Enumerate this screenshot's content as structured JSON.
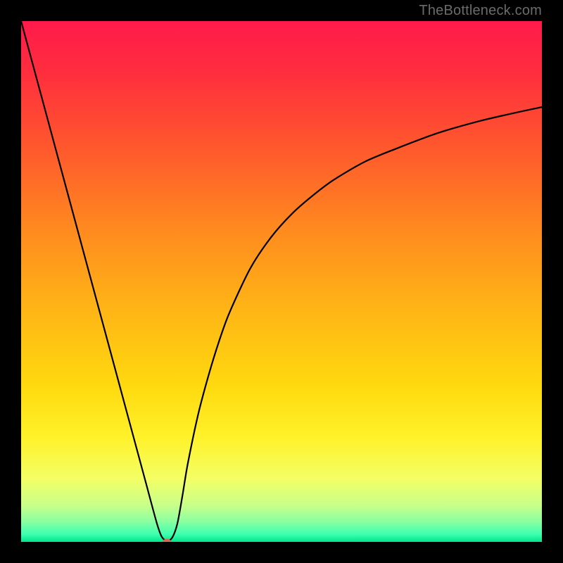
{
  "watermark": "TheBottleneck.com",
  "chart_data": {
    "type": "line",
    "title": "",
    "xlabel": "",
    "ylabel": "",
    "xlim": [
      0,
      100
    ],
    "ylim": [
      0,
      100
    ],
    "grid": false,
    "legend": false,
    "background_gradient": {
      "direction": "vertical",
      "stops": [
        {
          "pos": 0.0,
          "color": "#ff1a4b"
        },
        {
          "pos": 0.1,
          "color": "#ff2e3e"
        },
        {
          "pos": 0.25,
          "color": "#ff5a2c"
        },
        {
          "pos": 0.4,
          "color": "#ff8a1f"
        },
        {
          "pos": 0.55,
          "color": "#ffb416"
        },
        {
          "pos": 0.7,
          "color": "#ffd90f"
        },
        {
          "pos": 0.8,
          "color": "#fff22a"
        },
        {
          "pos": 0.88,
          "color": "#f3ff66"
        },
        {
          "pos": 0.93,
          "color": "#c8ff8a"
        },
        {
          "pos": 0.96,
          "color": "#8cffa0"
        },
        {
          "pos": 0.985,
          "color": "#3fffb0"
        },
        {
          "pos": 1.0,
          "color": "#00e58c"
        }
      ]
    },
    "series": [
      {
        "name": "bottleneck-curve",
        "color": "#000000",
        "stroke_width": 2.2,
        "x": [
          0,
          2,
          4,
          6,
          8,
          10,
          12,
          14,
          16,
          18,
          20,
          22,
          24,
          26,
          27,
          28,
          29,
          30,
          31,
          32,
          34,
          36,
          38,
          40,
          44,
          48,
          52,
          56,
          60,
          66,
          72,
          80,
          88,
          94,
          100
        ],
        "y": [
          100,
          92.6,
          85.2,
          77.8,
          70.4,
          63.0,
          55.6,
          48.2,
          40.8,
          33.4,
          26.0,
          18.6,
          11.2,
          3.8,
          1.0,
          0.2,
          0.8,
          3.5,
          9.0,
          15.0,
          24.5,
          32.0,
          38.5,
          44.0,
          52.5,
          58.5,
          63.0,
          66.5,
          69.5,
          73.0,
          75.5,
          78.5,
          80.8,
          82.2,
          83.5
        ]
      }
    ],
    "marker": {
      "name": "minimum-marker",
      "x": 28,
      "y": 0,
      "color": "#d86a4a",
      "rx": 6,
      "ry": 4.5
    }
  }
}
